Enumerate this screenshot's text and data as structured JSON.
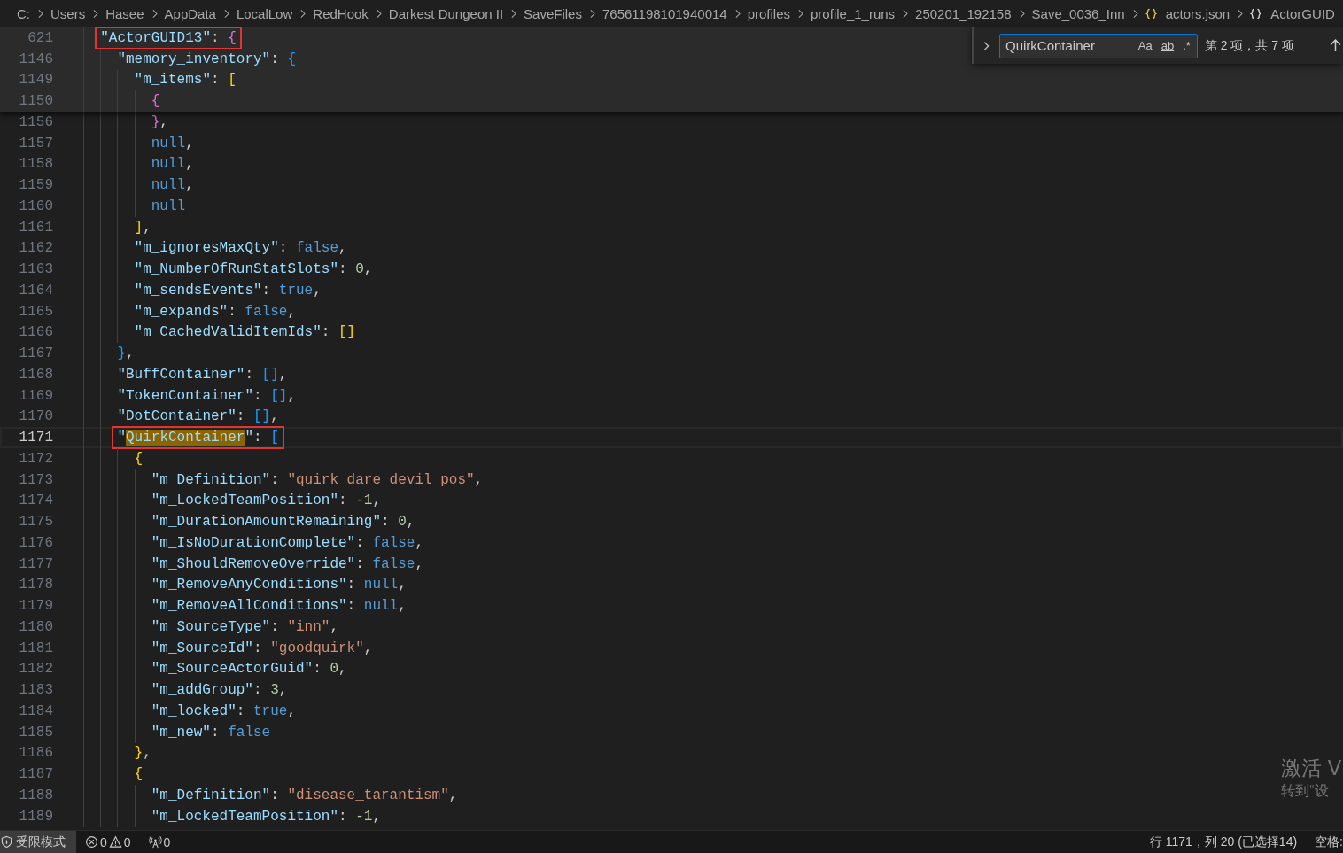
{
  "breadcrumbs": [
    {
      "kind": "folder",
      "label": "C:"
    },
    {
      "kind": "folder",
      "label": "Users"
    },
    {
      "kind": "folder",
      "label": "Hasee"
    },
    {
      "kind": "folder",
      "label": "AppData"
    },
    {
      "kind": "folder",
      "label": "LocalLow"
    },
    {
      "kind": "folder",
      "label": "RedHook"
    },
    {
      "kind": "folder",
      "label": "Darkest Dungeon II"
    },
    {
      "kind": "folder",
      "label": "SaveFiles"
    },
    {
      "kind": "folder",
      "label": "76561198101940014"
    },
    {
      "kind": "folder",
      "label": "profiles"
    },
    {
      "kind": "folder",
      "label": "profile_1_runs"
    },
    {
      "kind": "folder",
      "label": "250201_192158"
    },
    {
      "kind": "folder",
      "label": "Save_0036_Inn"
    },
    {
      "kind": "file",
      "label": "actors.json"
    },
    {
      "kind": "symbol",
      "label": "ActorGUID"
    }
  ],
  "find_widget": {
    "value": "QuirkContainer",
    "options": [
      "Aa",
      "ab",
      ".*"
    ],
    "count": "第 2 项，共 7 项"
  },
  "lines": [
    {
      "number": "621",
      "sticky": true,
      "boxed": true,
      "current": false,
      "tokens": [
        {
          "kind": "key",
          "text": "\"ActorGUID13\""
        },
        {
          "kind": "punct",
          "text": ": "
        },
        {
          "kind": "bracket",
          "text": "{",
          "color": "#da70d6"
        }
      ],
      "children": [
        {
          "number": "1146",
          "sticky": true,
          "boxed": false,
          "current": false,
          "tokens": [
            {
              "kind": "key",
              "text": "\"memory_inventory\""
            },
            {
              "kind": "punct",
              "text": ": "
            },
            {
              "kind": "bracket",
              "text": "{",
              "color": "#179fff"
            }
          ],
          "children": [
            {
              "number": "1149",
              "sticky": true,
              "boxed": false,
              "current": false,
              "tokens": [
                {
                  "kind": "key",
                  "text": "\"m_items\""
                },
                {
                  "kind": "punct",
                  "text": ": "
                },
                {
                  "kind": "bracket",
                  "text": "[",
                  "color": "#ffd700"
                }
              ],
              "children": [
                {
                  "number": "1150",
                  "sticky": true,
                  "boxed": false,
                  "current": false,
                  "tokens": [
                    {
                      "kind": "bracket",
                      "text": "{",
                      "color": "#da70d6"
                    }
                  ]
                },
                {
                  "number": "1156",
                  "sticky": false,
                  "boxed": false,
                  "current": false,
                  "tokens": [
                    {
                      "kind": "bracket",
                      "text": "}",
                      "color": "#da70d6"
                    },
                    {
                      "kind": "punct",
                      "text": ","
                    }
                  ]
                },
                {
                  "number": "1157",
                  "sticky": false,
                  "boxed": false,
                  "current": false,
                  "tokens": [
                    {
                      "kind": "keyword",
                      "text": "null"
                    },
                    {
                      "kind": "punct",
                      "text": ","
                    }
                  ]
                },
                {
                  "number": "1158",
                  "sticky": false,
                  "boxed": false,
                  "current": false,
                  "tokens": [
                    {
                      "kind": "keyword",
                      "text": "null"
                    },
                    {
                      "kind": "punct",
                      "text": ","
                    }
                  ]
                },
                {
                  "number": "1159",
                  "sticky": false,
                  "boxed": false,
                  "current": false,
                  "tokens": [
                    {
                      "kind": "keyword",
                      "text": "null"
                    },
                    {
                      "kind": "punct",
                      "text": ","
                    }
                  ]
                },
                {
                  "number": "1160",
                  "sticky": false,
                  "boxed": false,
                  "current": false,
                  "tokens": [
                    {
                      "kind": "keyword",
                      "text": "null"
                    }
                  ]
                }
              ]
            },
            {
              "number": "1161",
              "sticky": false,
              "boxed": false,
              "current": false,
              "tokens": [
                {
                  "kind": "bracket",
                  "text": "]",
                  "color": "#ffd700"
                },
                {
                  "kind": "punct",
                  "text": ","
                }
              ]
            },
            {
              "number": "1162",
              "sticky": false,
              "boxed": false,
              "current": false,
              "tokens": [
                {
                  "kind": "key",
                  "text": "\"m_ignoresMaxQty\""
                },
                {
                  "kind": "punct",
                  "text": ": "
                },
                {
                  "kind": "keyword",
                  "text": "false"
                },
                {
                  "kind": "punct",
                  "text": ","
                }
              ]
            },
            {
              "number": "1163",
              "sticky": false,
              "boxed": false,
              "current": false,
              "tokens": [
                {
                  "kind": "key",
                  "text": "\"m_NumberOfRunStatSlots\""
                },
                {
                  "kind": "punct",
                  "text": ": "
                },
                {
                  "kind": "number",
                  "text": "0"
                },
                {
                  "kind": "punct",
                  "text": ","
                }
              ]
            },
            {
              "number": "1164",
              "sticky": false,
              "boxed": false,
              "current": false,
              "tokens": [
                {
                  "kind": "key",
                  "text": "\"m_sendsEvents\""
                },
                {
                  "kind": "punct",
                  "text": ": "
                },
                {
                  "kind": "keyword",
                  "text": "true"
                },
                {
                  "kind": "punct",
                  "text": ","
                }
              ]
            },
            {
              "number": "1165",
              "sticky": false,
              "boxed": false,
              "current": false,
              "tokens": [
                {
                  "kind": "key",
                  "text": "\"m_expands\""
                },
                {
                  "kind": "punct",
                  "text": ": "
                },
                {
                  "kind": "keyword",
                  "text": "false"
                },
                {
                  "kind": "punct",
                  "text": ","
                }
              ]
            },
            {
              "number": "1166",
              "sticky": false,
              "boxed": false,
              "current": false,
              "tokens": [
                {
                  "kind": "key",
                  "text": "\"m_CachedValidItemIds\""
                },
                {
                  "kind": "punct",
                  "text": ": "
                },
                {
                  "kind": "bracket",
                  "text": "[]",
                  "color": "#ffd700"
                }
              ]
            }
          ]
        },
        {
          "number": "1167",
          "sticky": false,
          "boxed": false,
          "current": false,
          "tokens": [
            {
              "kind": "bracket",
              "text": "}",
              "color": "#179fff"
            },
            {
              "kind": "punct",
              "text": ","
            }
          ]
        },
        {
          "number": "1168",
          "sticky": false,
          "boxed": false,
          "current": false,
          "tokens": [
            {
              "kind": "key",
              "text": "\"BuffContainer\""
            },
            {
              "kind": "punct",
              "text": ": "
            },
            {
              "kind": "bracket",
              "text": "[]",
              "color": "#179fff"
            },
            {
              "kind": "punct",
              "text": ","
            }
          ]
        },
        {
          "number": "1169",
          "sticky": false,
          "boxed": false,
          "current": false,
          "tokens": [
            {
              "kind": "key",
              "text": "\"TokenContainer\""
            },
            {
              "kind": "punct",
              "text": ": "
            },
            {
              "kind": "bracket",
              "text": "[]",
              "color": "#179fff"
            },
            {
              "kind": "punct",
              "text": ","
            }
          ]
        },
        {
          "number": "1170",
          "sticky": false,
          "boxed": false,
          "current": false,
          "tokens": [
            {
              "kind": "key",
              "text": "\"DotContainer\""
            },
            {
              "kind": "punct",
              "text": ": "
            },
            {
              "kind": "bracket",
              "text": "[]",
              "color": "#179fff"
            },
            {
              "kind": "punct",
              "text": ","
            }
          ]
        },
        {
          "number": "1171",
          "sticky": false,
          "boxed": true,
          "current": true,
          "tokens": [
            {
              "kind": "key",
              "text": "\"",
              "match": false
            },
            {
              "kind": "key",
              "text": "QuirkContainer",
              "match": true
            },
            {
              "kind": "key",
              "text": "\"",
              "match": false
            },
            {
              "kind": "punct",
              "text": ": "
            },
            {
              "kind": "bracket",
              "text": "[",
              "color": "#179fff"
            }
          ],
          "children": [
            {
              "number": "1172",
              "sticky": false,
              "boxed": false,
              "current": false,
              "tokens": [
                {
                  "kind": "bracket",
                  "text": "{",
                  "color": "#ffd700"
                }
              ],
              "children": [
                {
                  "number": "1173",
                  "sticky": false,
                  "boxed": false,
                  "current": false,
                  "tokens": [
                    {
                      "kind": "key",
                      "text": "\"m_Definition\""
                    },
                    {
                      "kind": "punct",
                      "text": ": "
                    },
                    {
                      "kind": "string",
                      "text": "\"quirk_dare_devil_pos\""
                    },
                    {
                      "kind": "punct",
                      "text": ","
                    }
                  ]
                },
                {
                  "number": "1174",
                  "sticky": false,
                  "boxed": false,
                  "current": false,
                  "tokens": [
                    {
                      "kind": "key",
                      "text": "\"m_LockedTeamPosition\""
                    },
                    {
                      "kind": "punct",
                      "text": ": "
                    },
                    {
                      "kind": "number",
                      "text": "-1"
                    },
                    {
                      "kind": "punct",
                      "text": ","
                    }
                  ]
                },
                {
                  "number": "1175",
                  "sticky": false,
                  "boxed": false,
                  "current": false,
                  "tokens": [
                    {
                      "kind": "key",
                      "text": "\"m_DurationAmountRemaining\""
                    },
                    {
                      "kind": "punct",
                      "text": ": "
                    },
                    {
                      "kind": "number",
                      "text": "0"
                    },
                    {
                      "kind": "punct",
                      "text": ","
                    }
                  ]
                },
                {
                  "number": "1176",
                  "sticky": false,
                  "boxed": false,
                  "current": false,
                  "tokens": [
                    {
                      "kind": "key",
                      "text": "\"m_IsNoDurationComplete\""
                    },
                    {
                      "kind": "punct",
                      "text": ": "
                    },
                    {
                      "kind": "keyword",
                      "text": "false"
                    },
                    {
                      "kind": "punct",
                      "text": ","
                    }
                  ]
                },
                {
                  "number": "1177",
                  "sticky": false,
                  "boxed": false,
                  "current": false,
                  "tokens": [
                    {
                      "kind": "key",
                      "text": "\"m_ShouldRemoveOverride\""
                    },
                    {
                      "kind": "punct",
                      "text": ": "
                    },
                    {
                      "kind": "keyword",
                      "text": "false"
                    },
                    {
                      "kind": "punct",
                      "text": ","
                    }
                  ]
                },
                {
                  "number": "1178",
                  "sticky": false,
                  "boxed": false,
                  "current": false,
                  "tokens": [
                    {
                      "kind": "key",
                      "text": "\"m_RemoveAnyConditions\""
                    },
                    {
                      "kind": "punct",
                      "text": ": "
                    },
                    {
                      "kind": "keyword",
                      "text": "null"
                    },
                    {
                      "kind": "punct",
                      "text": ","
                    }
                  ]
                },
                {
                  "number": "1179",
                  "sticky": false,
                  "boxed": false,
                  "current": false,
                  "tokens": [
                    {
                      "kind": "key",
                      "text": "\"m_RemoveAllConditions\""
                    },
                    {
                      "kind": "punct",
                      "text": ": "
                    },
                    {
                      "kind": "keyword",
                      "text": "null"
                    },
                    {
                      "kind": "punct",
                      "text": ","
                    }
                  ]
                },
                {
                  "number": "1180",
                  "sticky": false,
                  "boxed": false,
                  "current": false,
                  "tokens": [
                    {
                      "kind": "key",
                      "text": "\"m_SourceType\""
                    },
                    {
                      "kind": "punct",
                      "text": ": "
                    },
                    {
                      "kind": "string",
                      "text": "\"inn\""
                    },
                    {
                      "kind": "punct",
                      "text": ","
                    }
                  ]
                },
                {
                  "number": "1181",
                  "sticky": false,
                  "boxed": false,
                  "current": false,
                  "tokens": [
                    {
                      "kind": "key",
                      "text": "\"m_SourceId\""
                    },
                    {
                      "kind": "punct",
                      "text": ": "
                    },
                    {
                      "kind": "string",
                      "text": "\"goodquirk\""
                    },
                    {
                      "kind": "punct",
                      "text": ","
                    }
                  ]
                },
                {
                  "number": "1182",
                  "sticky": false,
                  "boxed": false,
                  "current": false,
                  "tokens": [
                    {
                      "kind": "key",
                      "text": "\"m_SourceActorGuid\""
                    },
                    {
                      "kind": "punct",
                      "text": ": "
                    },
                    {
                      "kind": "number",
                      "text": "0"
                    },
                    {
                      "kind": "punct",
                      "text": ","
                    }
                  ]
                },
                {
                  "number": "1183",
                  "sticky": false,
                  "boxed": false,
                  "current": false,
                  "tokens": [
                    {
                      "kind": "key",
                      "text": "\"m_addGroup\""
                    },
                    {
                      "kind": "punct",
                      "text": ": "
                    },
                    {
                      "kind": "number",
                      "text": "3"
                    },
                    {
                      "kind": "punct",
                      "text": ","
                    }
                  ]
                },
                {
                  "number": "1184",
                  "sticky": false,
                  "boxed": false,
                  "current": false,
                  "tokens": [
                    {
                      "kind": "key",
                      "text": "\"m_locked\""
                    },
                    {
                      "kind": "punct",
                      "text": ": "
                    },
                    {
                      "kind": "keyword",
                      "text": "true"
                    },
                    {
                      "kind": "punct",
                      "text": ","
                    }
                  ]
                },
                {
                  "number": "1185",
                  "sticky": false,
                  "boxed": false,
                  "current": false,
                  "tokens": [
                    {
                      "kind": "key",
                      "text": "\"m_new\""
                    },
                    {
                      "kind": "punct",
                      "text": ": "
                    },
                    {
                      "kind": "keyword",
                      "text": "false"
                    }
                  ]
                }
              ]
            },
            {
              "number": "1186",
              "sticky": false,
              "boxed": false,
              "current": false,
              "tokens": [
                {
                  "kind": "bracket",
                  "text": "}",
                  "color": "#ffd700"
                },
                {
                  "kind": "punct",
                  "text": ","
                }
              ]
            },
            {
              "number": "1187",
              "sticky": false,
              "boxed": false,
              "current": false,
              "tokens": [
                {
                  "kind": "bracket",
                  "text": "{",
                  "color": "#ffd700"
                }
              ],
              "children": [
                {
                  "number": "1188",
                  "sticky": false,
                  "boxed": false,
                  "current": false,
                  "tokens": [
                    {
                      "kind": "key",
                      "text": "\"m_Definition\""
                    },
                    {
                      "kind": "punct",
                      "text": ": "
                    },
                    {
                      "kind": "string",
                      "text": "\"disease_tarantism\""
                    },
                    {
                      "kind": "punct",
                      "text": ","
                    }
                  ]
                },
                {
                  "number": "1189",
                  "sticky": false,
                  "boxed": false,
                  "current": false,
                  "tokens": [
                    {
                      "kind": "key",
                      "text": "\"m_LockedTeamPosition\""
                    },
                    {
                      "kind": "punct",
                      "text": ": "
                    },
                    {
                      "kind": "number",
                      "text": "-1"
                    },
                    {
                      "kind": "punct",
                      "text": ","
                    }
                  ]
                }
              ]
            }
          ]
        }
      ]
    }
  ],
  "activation_notice": {
    "title": "激活 V",
    "subtitle": "转到“设"
  },
  "status_bar": {
    "restricted_mode": "受限模式",
    "errors": "0",
    "warnings": "0",
    "ports": "0",
    "cursor_position": "行 1171，列 20 (已选择14)",
    "indentation": "空格:"
  }
}
